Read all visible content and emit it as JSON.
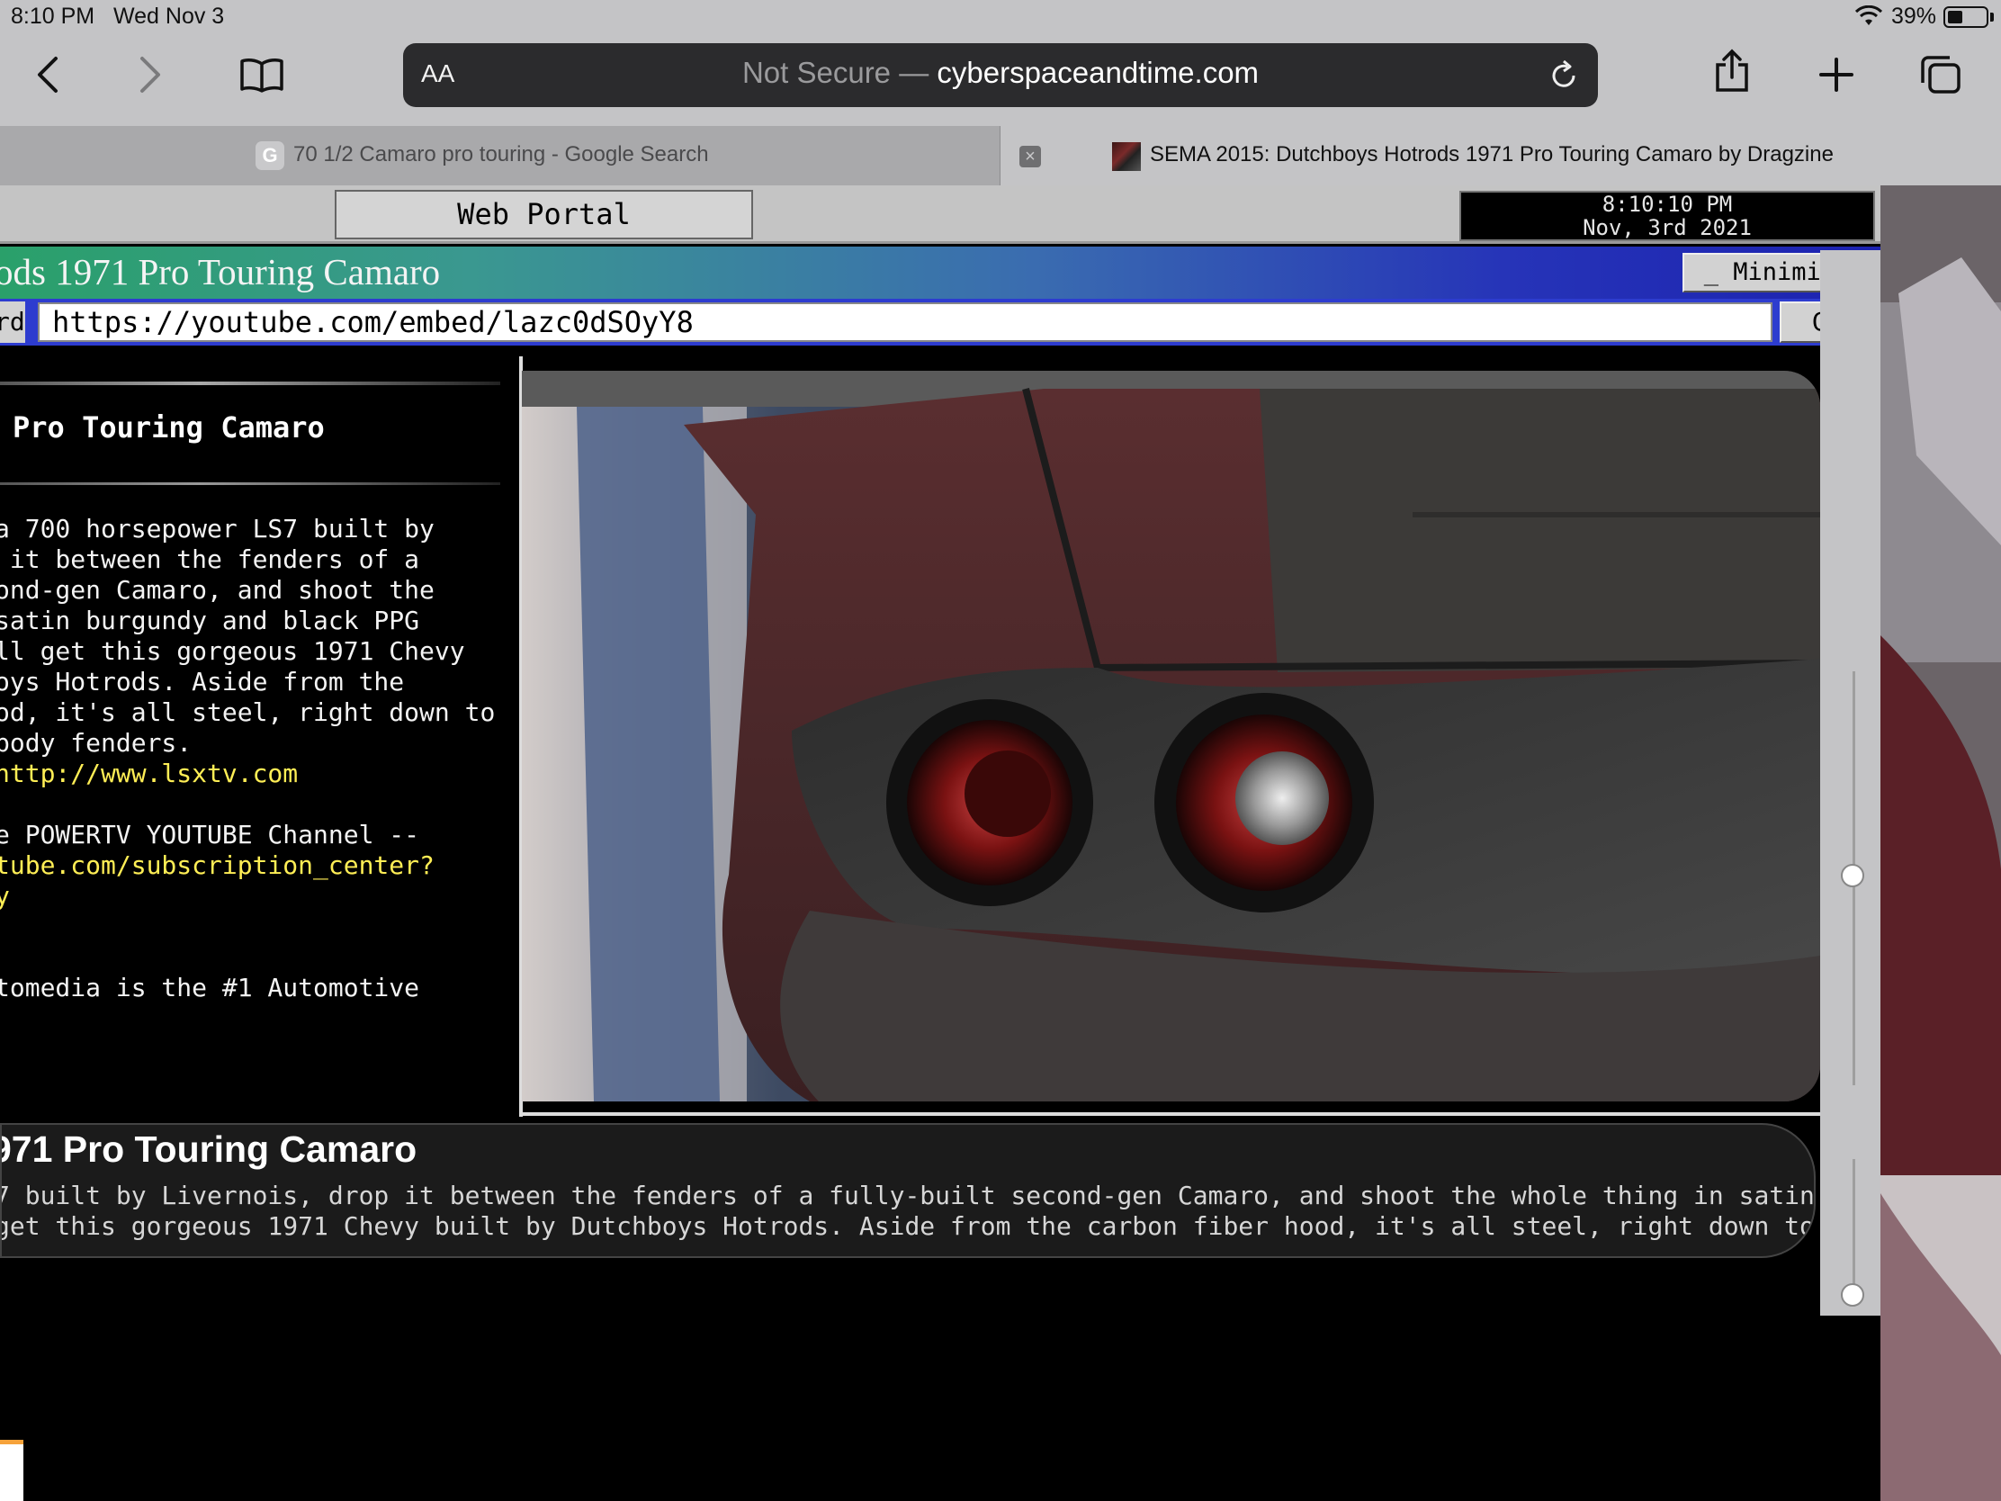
{
  "status": {
    "time": "8:10 PM",
    "date": "Wed Nov 3",
    "battery": "39%",
    "battery_level": 0.39
  },
  "toolbar": {
    "text_size": "AA",
    "security": "Not Secure —",
    "domain": "cyberspaceandtime.com",
    "icons": [
      "back-icon",
      "forward-icon",
      "bookmarks-icon",
      "reload-icon",
      "share-icon",
      "new-tab-icon",
      "tabs-icon"
    ]
  },
  "tabs": [
    {
      "favicon": "G",
      "title": "70 1/2 Camaro pro touring - Google Search"
    },
    {
      "title": "SEMA 2015: Dutchboys Hotrods 1971 Pro Touring Camaro by Dragzine"
    }
  ],
  "portal": {
    "button": "Web Portal",
    "clock_time": "8:10:10 PM",
    "clock_date": "Nov, 3rd 2021"
  },
  "window": {
    "title": "ods 1971 Pro Touring Camaro",
    "minimize": "_ Minimize",
    "addr_label": "rd",
    "address": "https://youtube.com/embed/lazc0dSOyY8",
    "go": "Go"
  },
  "description": {
    "heading": "Pro Touring Camaro",
    "lines": [
      "a 700 horsepower LS7 built by",
      " it between the fenders of a",
      "ond-gen Camaro, and shoot the",
      "satin burgundy and black PPG",
      "ll get this gorgeous 1971 Chevy",
      "oys Hotrods. Aside from the",
      "od, it's all steel, right down to",
      "body fenders."
    ],
    "link1": "http://www.lsxtv.com",
    "line_channel": "e POWERTV YOUTUBE Channel --",
    "link2a": "tube.com/subscription_center?",
    "link2b": "y",
    "line_last": "tomedia is the #1 Automotive"
  },
  "info": {
    "title": "971 Pro Touring Camaro",
    "line1": "7 built by Livernois, drop it between the fenders of a fully-built second-gen Camaro, and shoot the whole thing in satin",
    "line2": "get this gorgeous 1971 Chevy built by Dutchboys Hotrods. Aside from the carbon fiber hood, it's all steel, right down to"
  }
}
